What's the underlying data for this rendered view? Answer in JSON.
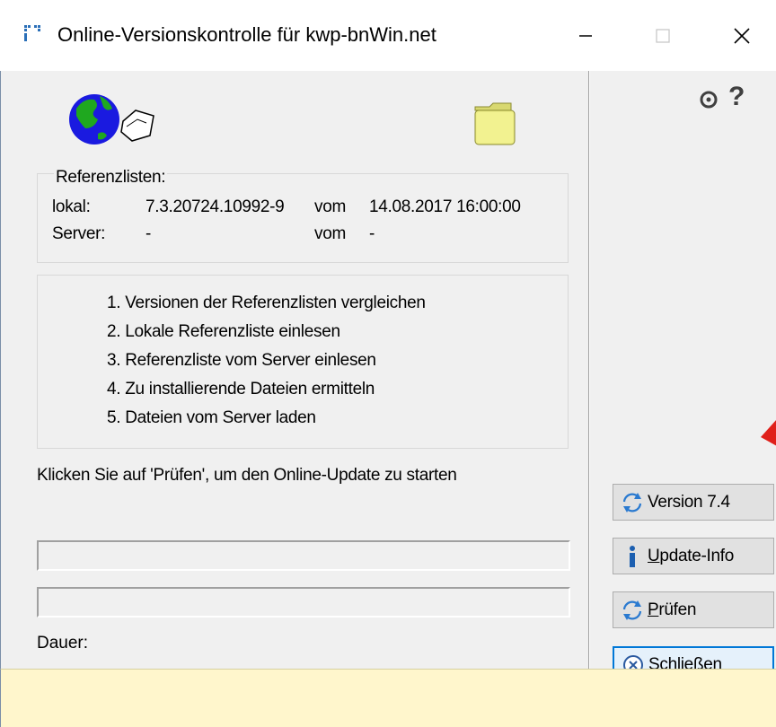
{
  "window": {
    "title": "Online-Versionskontrolle für kwp-bnWin.net",
    "minimize_icon": "minimize-icon",
    "maximize_icon": "maximize-icon",
    "close_icon": "close-icon"
  },
  "referenzlisten": {
    "title": "Referenzlisten:",
    "lokal_label": "lokal:",
    "lokal_version": "7.3.20724.10992-9",
    "lokal_vom_label": "vom",
    "lokal_date": "14.08.2017 16:00:00",
    "server_label": "Server:",
    "server_version": "-",
    "server_vom_label": "vom",
    "server_date": "-"
  },
  "steps": [
    "1. Versionen der Referenzlisten vergleichen",
    "2. Lokale Referenzliste einlesen",
    "3. Referenzliste vom Server einlesen",
    "4. Zu installierende Dateien ermitteln",
    "5. Dateien vom Server laden"
  ],
  "hint": "Klicken Sie auf 'Prüfen', um den Online-Update zu starten",
  "progress": {
    "bar1": 0,
    "bar2": 0
  },
  "dauer_label": "Dauer:",
  "help_label": "?",
  "buttons": {
    "version": "Version 7.4",
    "update_info_accel": "U",
    "update_info_rest": "pdate-Info",
    "pruefen_accel": "P",
    "pruefen_rest": "rüfen",
    "schliessen": "Schließen"
  },
  "status_text": "",
  "colors": {
    "client_bg": "#f0f0f0",
    "statusbar_bg": "#fff6cc",
    "accent": "#0078d7",
    "arrow": "#e0201a"
  },
  "icons": {
    "app": "app-icon",
    "globe": "globe-document-icon",
    "folder": "folder-icon",
    "settings": "settings-icon",
    "refresh": "refresh-icon",
    "info": "info-icon",
    "close_circle": "close-circle-icon"
  }
}
